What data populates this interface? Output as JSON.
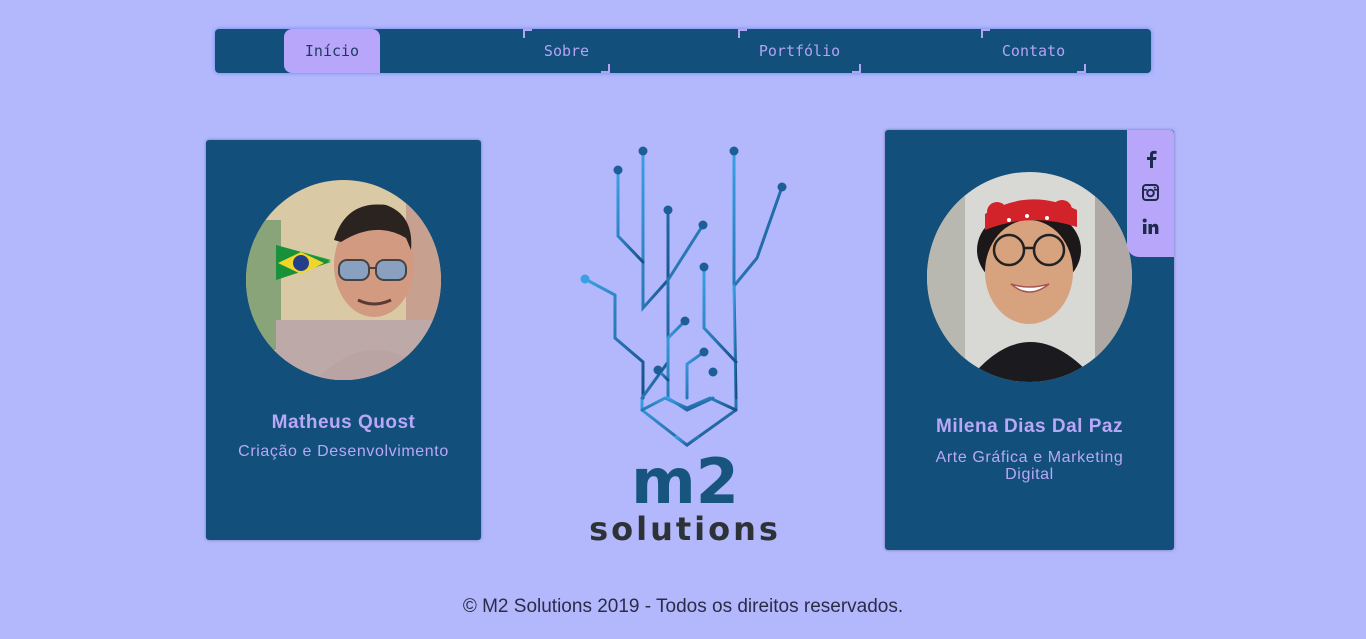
{
  "nav": {
    "items": [
      {
        "label": "Início",
        "active": true
      },
      {
        "label": "Sobre",
        "active": false
      },
      {
        "label": "Portfólio",
        "active": false
      },
      {
        "label": "Contato",
        "active": false
      }
    ]
  },
  "team": [
    {
      "name": "Matheus Quost",
      "role": "Criação e Desenvolvimento"
    },
    {
      "name": "Milena Dias Dal Paz",
      "role": "Arte Gráfica e Marketing Digital"
    }
  ],
  "social": {
    "icons": [
      "facebook-icon",
      "instagram-icon",
      "linkedin-icon"
    ]
  },
  "logo": {
    "line1": "m2",
    "line2": "solutions"
  },
  "footer": {
    "text": "© M2 Solutions 2019 - Todos os direitos reservados."
  },
  "colors": {
    "background": "#b3b8fd",
    "panel": "#124f7a",
    "accent": "#b8a6fb",
    "logo_blue": "#1c6fae"
  }
}
